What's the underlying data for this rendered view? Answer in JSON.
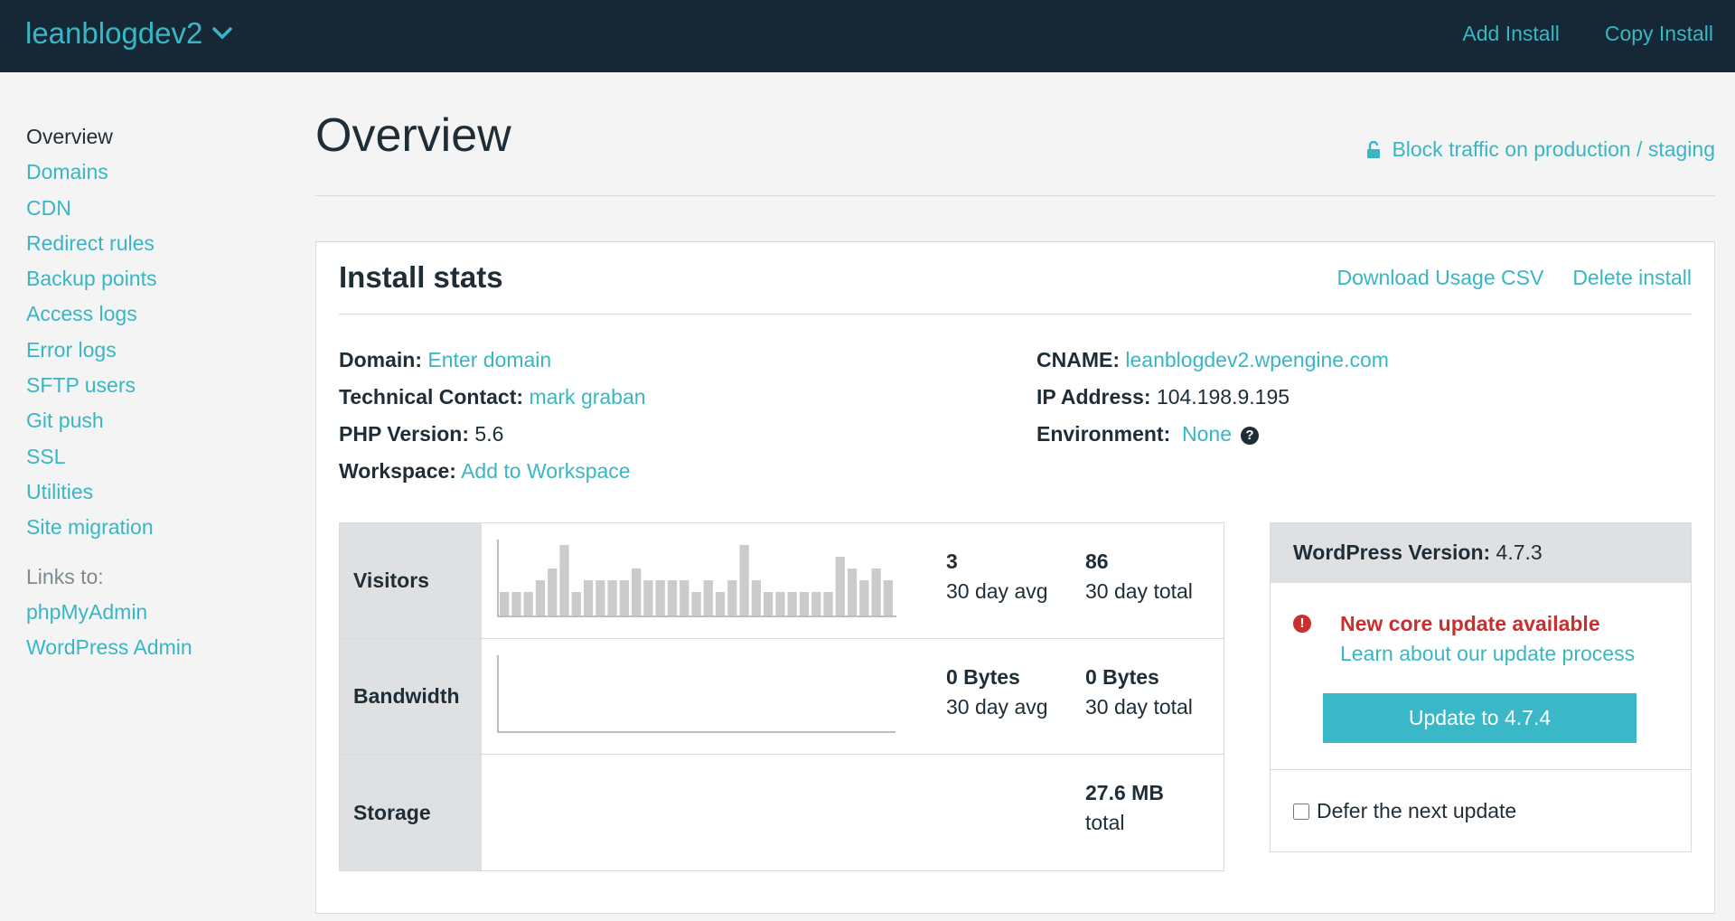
{
  "topbar": {
    "site_name": "leanblogdev2",
    "add_install": "Add Install",
    "copy_install": "Copy Install"
  },
  "sidebar": {
    "current": "Overview",
    "items": [
      "Domains",
      "CDN",
      "Redirect rules",
      "Backup points",
      "Access logs",
      "Error logs",
      "SFTP users",
      "Git push",
      "SSL",
      "Utilities",
      "Site migration"
    ],
    "links_label": "Links to:",
    "links": [
      "phpMyAdmin",
      "WordPress Admin"
    ]
  },
  "main": {
    "title": "Overview",
    "block_traffic": "Block traffic on production / staging"
  },
  "panel": {
    "title": "Install stats",
    "download_csv": "Download Usage CSV",
    "delete_install": "Delete install",
    "domain_label": "Domain:",
    "domain_value": "Enter domain",
    "tech_label": "Technical Contact:",
    "tech_value": "mark graban",
    "php_label": "PHP Version:",
    "php_value": "5.6",
    "workspace_label": "Workspace:",
    "workspace_value": "Add to Workspace",
    "cname_label": "CNAME:",
    "cname_value": "leanblogdev2.wpengine.com",
    "ip_label": "IP Address:",
    "ip_value": "104.198.9.195",
    "env_label": "Environment:",
    "env_value": "None"
  },
  "stats": {
    "visitors": {
      "label": "Visitors",
      "avg_value": "3",
      "avg_label": "30 day avg",
      "total_value": "86",
      "total_label": "30 day total",
      "daily": [
        2,
        2,
        2,
        3,
        4,
        6,
        2,
        3,
        3,
        3,
        3,
        4,
        3,
        3,
        3,
        3,
        2,
        3,
        2,
        3,
        6,
        3,
        2,
        2,
        2,
        2,
        2,
        2,
        5,
        4,
        3,
        4,
        3
      ]
    },
    "bandwidth": {
      "label": "Bandwidth",
      "avg_value": "0 Bytes",
      "avg_label": "30 day avg",
      "total_value": "0 Bytes",
      "total_label": "30 day total"
    },
    "storage": {
      "label": "Storage",
      "total_value": "27.6 MB",
      "total_label": "total"
    }
  },
  "wordpress": {
    "version_label": "WordPress Version:",
    "version_value": "4.7.3",
    "alert_title": "New core update available",
    "alert_link": "Learn about our update process",
    "update_button": "Update to 4.7.4",
    "defer_label": "Defer the next update",
    "defer_checked": false
  },
  "colors": {
    "accent": "#38b6c5",
    "topbar": "#162835",
    "alert": "#c92f2f"
  }
}
